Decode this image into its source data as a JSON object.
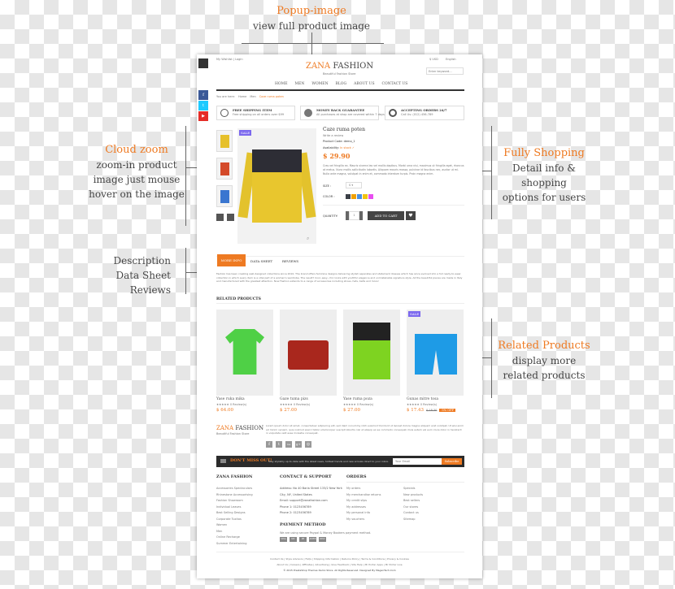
{
  "annotations": {
    "popup": {
      "title": "Popup-image",
      "lines": [
        "view full product image"
      ]
    },
    "cloud": {
      "title": "Cloud zoom",
      "lines": [
        "zoom-in product",
        "image just mouse",
        "hover on the image"
      ]
    },
    "shopping": {
      "title": "Fully Shopping",
      "lines": [
        "Detail info &",
        "shopping",
        "options for users"
      ]
    },
    "desc": {
      "lines": [
        "Description",
        "Data Sheet",
        "Reviews"
      ]
    },
    "related": {
      "title": "Related Products",
      "lines": [
        "display more",
        "related products"
      ]
    }
  },
  "header": {
    "top_links": "My Wishlist | Login",
    "currency": "$ USD",
    "language": "English",
    "logo_a": "ZANA",
    "logo_b": " FASHION",
    "tagline": "Beautiful Fashion Store",
    "search_placeholder": "Enter keyword...",
    "nav": [
      "HOME",
      "MEN",
      "WOMEN",
      "BLOG",
      "ABOUT US",
      "CONTACT US"
    ],
    "breadcrumb": [
      "You are here:",
      "Home",
      "Men",
      "Caze ruma poten"
    ]
  },
  "features": [
    {
      "title": "FREE SHIPPING ITEM",
      "sub": "Free shipping on all orders over $99"
    },
    {
      "title": "MONEY BACK GUARANTEE",
      "sub": "All purchases at shop are covered within 7 days"
    },
    {
      "title": "ACCEPTING ORDERS 24/7",
      "sub": "Call Us: (012) 456-789"
    }
  ],
  "social": [
    "f",
    "t",
    "▶"
  ],
  "product": {
    "sale": "SALE",
    "name": "Caze ruma poten",
    "reviews": "Write a review",
    "code": "Product Code: demo_1",
    "availability_label": "Availability:",
    "availability": "In stock ✓",
    "price": "$ 29.90",
    "description": "Cras vel fringilla ex. Mauris viverra leo vel mollis dapibus. Morbi urna nisi, maximus ut fringilla eget, rhoncus at metus. Nunc mollis sollicitudin lobortis. Aliquam mauris massa, pulvinar id faucibus nec, auctor ut mi. Nulla ante magna, volutpat in enim et, commodo interdum turpis. Proin magna enim.",
    "size_label": "SIZE :",
    "size": "S",
    "color_label": "COLOR :",
    "colors": [
      "#3b3f47",
      "#f0a000",
      "#4a90e2",
      "#f1c40f",
      "#e84ef0"
    ],
    "qty_label": "QUANTITY:",
    "qty": "1",
    "add_to_cart": "ADD TO CART"
  },
  "tabs": [
    "MORE INFO",
    "DATA SHEET",
    "REVIEWS"
  ],
  "tab_text": "Fashion has been creating well-designed collections since 2010. The brand offers feminine designs delivering stylish separates and statement dresses which has since evolved into a full ready-to-wear collection in which every item is a vital part of a woman's wardrobe. The result? Cool, easy, chic looks with youthful elegance and unmistakable signature style. All the beautiful pieces are made in Italy and manufactured with the greatest attention. Now Fashion extends to a range of accessories including shoes, hats, belts and more!",
  "related": {
    "title": "RELATED PRODUCTS",
    "items": [
      {
        "name": "Yase ruka mika",
        "stars": "★★★★★",
        "reviews": "0 Review(s)",
        "price": "$ 64.00"
      },
      {
        "name": "Gaze tuma pizs",
        "stars": "★★★★★",
        "reviews": "0 Review(s)",
        "price": "$ 27.00"
      },
      {
        "name": "Yase ruma poza",
        "stars": "★★★★★",
        "reviews": "0 Review(s)",
        "price": "$ 27.00"
      },
      {
        "name": "Gunas mitre tosa",
        "stars": "★★★★★",
        "reviews": "0 Review(s)",
        "price": "$ 17.43",
        "old_price": "$ 18.30",
        "discount": "-5% OFF",
        "sale": "SALE"
      }
    ]
  },
  "footer": {
    "about": "Lorem ipsum dolor sit amet, consectetuer adipiscing elit, sed diam nonummy nibh euismod tincidunt ut laoreet dolore magna aliquam erat volutpat. Ut wisi enim ad minim veniam, quis nostrud exerci tation ullamcorper suscipit lobortis nisl ut aliquip ex ea commodo consequat. Duis autem vel eum iriure dolor in hendrerit in vulputate velit esse molestie consequat.",
    "social": [
      "f",
      "t",
      "rss",
      "g+",
      "◎"
    ],
    "newsletter_title": "DON'T MISS OUT!",
    "newsletter_text": "Stay stylishly up-to-date with the latest news, hottest trends and new arrivals direct to your inbox.",
    "email_placeholder": "Your Email",
    "subscribe": "Subscribe",
    "col1_title": "ZANA FASHION",
    "col1": [
      "Accessories Spectaculars",
      "Rhinestone Accessorising",
      "Fashion Showroom",
      "Individual Leaves",
      "Best Selling Designs",
      "Corporate Tuxitos",
      "Women",
      "Men",
      "Online Recharge",
      "Summer Entertaining"
    ],
    "contact_title": "CONTACT & SUPPORT",
    "contact": [
      "Address: No 40 Baria Street 133/2 New York",
      "City, NY, United States",
      "Email: support@zanafashion.com",
      "Phone 1: 0123456789",
      "Phone 2: 0123456789"
    ],
    "payment_title": "PAYMENT METHOD",
    "payment_text": "We are using secure Paypal & Money Bookers payment method.",
    "payment_icons": [
      "VISA",
      "MC",
      "PP",
      "AMEX",
      "DISC"
    ],
    "orders_title": "ORDERS",
    "orders1": [
      "My orders",
      "My merchandise returns",
      "My credit slips",
      "My addresses",
      "My personal info",
      "My vouchers"
    ],
    "orders2": [
      "Specials",
      "New products",
      "Best sellers",
      "Our stores",
      "Contact us",
      "Sitemap"
    ],
    "links1": "Contact Us | Style Advisors | FAQs | Shipping Information | Returns Policy | Terms & Conditions | Privacy & Cookies",
    "links2": "About Us | Careers | Affiliates | Advertising | Give Feedback | Site Help | Mr Porter Apps | Mr Porter Live",
    "copyright": "© 2015 PrestaShop Themes Demo Store. All Rights Reserved. Designed By MagenTech.Com"
  }
}
